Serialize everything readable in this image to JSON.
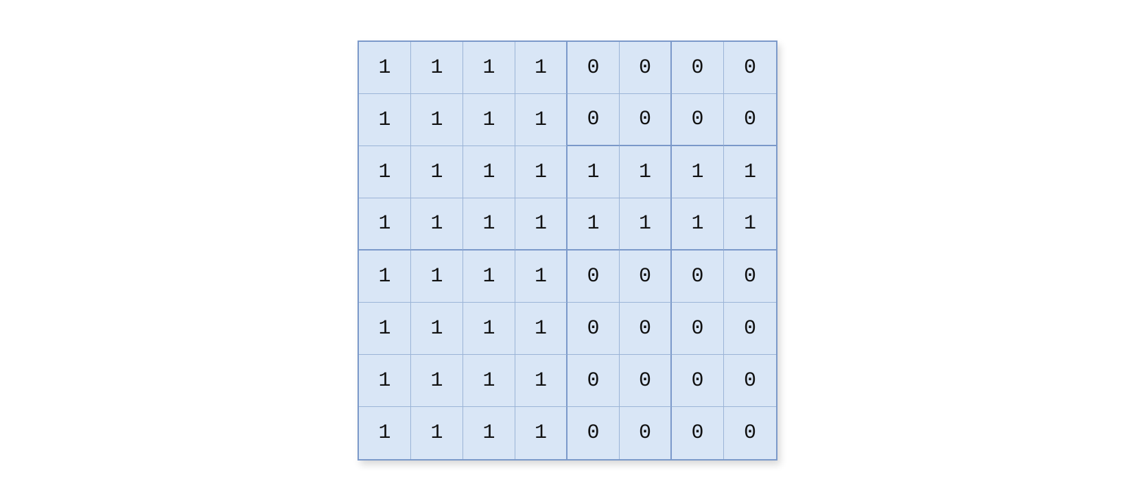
{
  "matrix": {
    "rows": 8,
    "cols": 8,
    "cell_size": 76,
    "values": [
      [
        1,
        1,
        1,
        1,
        0,
        0,
        0,
        0
      ],
      [
        1,
        1,
        1,
        1,
        0,
        0,
        0,
        0
      ],
      [
        1,
        1,
        1,
        1,
        1,
        1,
        1,
        1
      ],
      [
        1,
        1,
        1,
        1,
        1,
        1,
        1,
        1
      ],
      [
        1,
        1,
        1,
        1,
        0,
        0,
        0,
        0
      ],
      [
        1,
        1,
        1,
        1,
        0,
        0,
        0,
        0
      ],
      [
        1,
        1,
        1,
        1,
        0,
        0,
        0,
        0
      ],
      [
        1,
        1,
        1,
        1,
        0,
        0,
        0,
        0
      ]
    ],
    "thick_vertical_after_cols": [
      3,
      5
    ],
    "thick_horizontal_segments": [
      {
        "after_row": 1,
        "from_col": 4,
        "to_col": 7
      },
      {
        "after_row": 3,
        "from_col": 0,
        "to_col": 7
      }
    ]
  }
}
